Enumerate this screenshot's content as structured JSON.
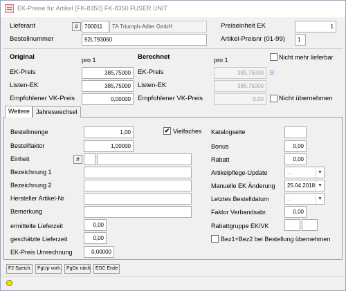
{
  "window": {
    "title": "EK-Preise für Artikel (FK-8350) FK-8350 FUSER UNIT"
  },
  "header": {
    "lieferant_label": "Lieferant",
    "lieferant_hash": "#",
    "lieferant_nr": "700011",
    "lieferant_name": "TA Triumph-Adler GmbH",
    "bestellnummer_label": "Bestellnummer",
    "bestellnummer_value": "92L793060",
    "preiseinheit_label": "Preiseinheit EK",
    "preiseinheit_value": "1",
    "artikel_preisnr_label": "Artikel-Preisnr (01-99)",
    "artikel_preisnr_value": "1"
  },
  "prices": {
    "original_title": "Original",
    "original_pro": "pro 1",
    "berechnet_title": "Berechnet",
    "berechnet_pro": "pro 1",
    "nicht_lieferbar_label": "Nicht mehr lieferbar",
    "ek_preis_label": "EK-Preis",
    "ek_preis_value": "385,75000",
    "ek_preis_calc": "385,75000",
    "b_marker": "B",
    "listen_ek_label": "Listen-EK",
    "listen_ek_value": "385,75000",
    "listen_ek_calc": "385,75000",
    "vk_preis_label": "Empfohlener VK-Preis",
    "vk_preis_value": "0,00000",
    "vk_preis_calc": "0,00",
    "nicht_uebernehmen_label": "Nicht übernehmen"
  },
  "tabs": [
    {
      "label": "Weitere"
    },
    {
      "label": "Jahreswechsel"
    }
  ],
  "weitere": {
    "bestellmenge_label": "Bestellmenge",
    "bestellmenge_value": "1,00",
    "vielfaches_label": "Vielfaches",
    "vielfaches_checked": "✔",
    "bestellfaktor_label": "Bestellfaktor",
    "bestellfaktor_value": "1,00000",
    "einheit_label": "Einheit",
    "einheit_hash": "#",
    "bez1_label": "Bezeichnung 1",
    "bez2_label": "Bezeichnung 2",
    "hersteller_label": "Hersteller Artikel-Nr",
    "bemerkung_label": "Bemerkung",
    "ermittelte_lieferzeit_label": "ermittelte Lieferzeit",
    "ermittelte_lieferzeit_value": "0,00",
    "geschaetzte_lieferzeit_label": "geschätzte Lieferzeit",
    "geschaetzte_lieferzeit_value": "0,00",
    "ek_umrechnung_label": "EK-Preis Umrechnung",
    "ek_umrechnung_value": "0,00000",
    "katalogseite_label": "Katalogseite",
    "bonus_label": "Bonus",
    "bonus_value": "0,00",
    "rabatt_label": "Rabatt",
    "rabatt_value": "0,00",
    "artikelpflege_label": "Artikelpflege-Update",
    "artikelpflege_value": ". .",
    "manuelle_ek_label": "Manuelle EK Änderung",
    "manuelle_ek_value": "25.04.2018",
    "letztes_bestelldatum_label": "Letztes Bestelldatum",
    "letztes_bestelldatum_value": ". .",
    "faktor_label": "Faktor Verbandsabr.",
    "faktor_value": "0,00",
    "rabattgruppe_label": "Rabattgruppe EK/VK",
    "bez_uebernehmen_label": "Bez1+Bez2 bei Bestellung übernehmen"
  },
  "footer": {
    "f2": "F2 Speich.",
    "pgup": "PgUp vorh.",
    "pgdn": "PgDn näch",
    "esc": "ESC Ende"
  }
}
